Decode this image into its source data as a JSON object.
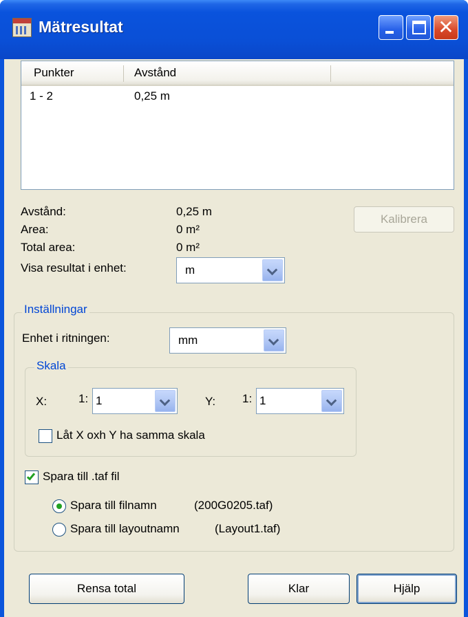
{
  "window": {
    "title": "Mätresultat"
  },
  "list": {
    "columns": [
      "Punkter",
      "Avstånd"
    ],
    "rows": [
      {
        "punkter": "1 - 2",
        "avstand": "0,25 m"
      }
    ]
  },
  "results": {
    "distance_label": "Avstånd:",
    "distance_value": "0,25 m",
    "area_label": "Area:",
    "area_value": "0 m²",
    "total_area_label": "Total area:",
    "total_area_value": "0 m²",
    "unit_label": "Visa resultat i enhet:",
    "unit_value": "m",
    "calibrate_label": "Kalibrera"
  },
  "settings": {
    "group_title": "Inställningar",
    "drawing_unit_label": "Enhet i ritningen:",
    "drawing_unit_value": "mm",
    "scale": {
      "group_title": "Skala",
      "x_label": "X:",
      "x_prefix": "1:",
      "x_value": "1",
      "y_label": "Y:",
      "y_prefix": "1:",
      "y_value": "1",
      "same_scale_label": "Låt X oxh Y ha samma skala",
      "same_scale_checked": false
    },
    "save_taf_label": "Spara till .taf fil",
    "save_taf_checked": true,
    "save_filename_label": "Spara till filnamn",
    "save_filename_value": "(200G0205.taf)",
    "save_layout_label": "Spara till layoutnamn",
    "save_layout_value": "(Layout1.taf)",
    "selected_option": "filename"
  },
  "buttons": {
    "clear_total": "Rensa total",
    "close": "Klar",
    "help": "Hjälp"
  },
  "colors": {
    "titlebar": "#0a53dd",
    "face": "#ece9d8",
    "group_title": "#0046d5",
    "check": "#21a121"
  }
}
